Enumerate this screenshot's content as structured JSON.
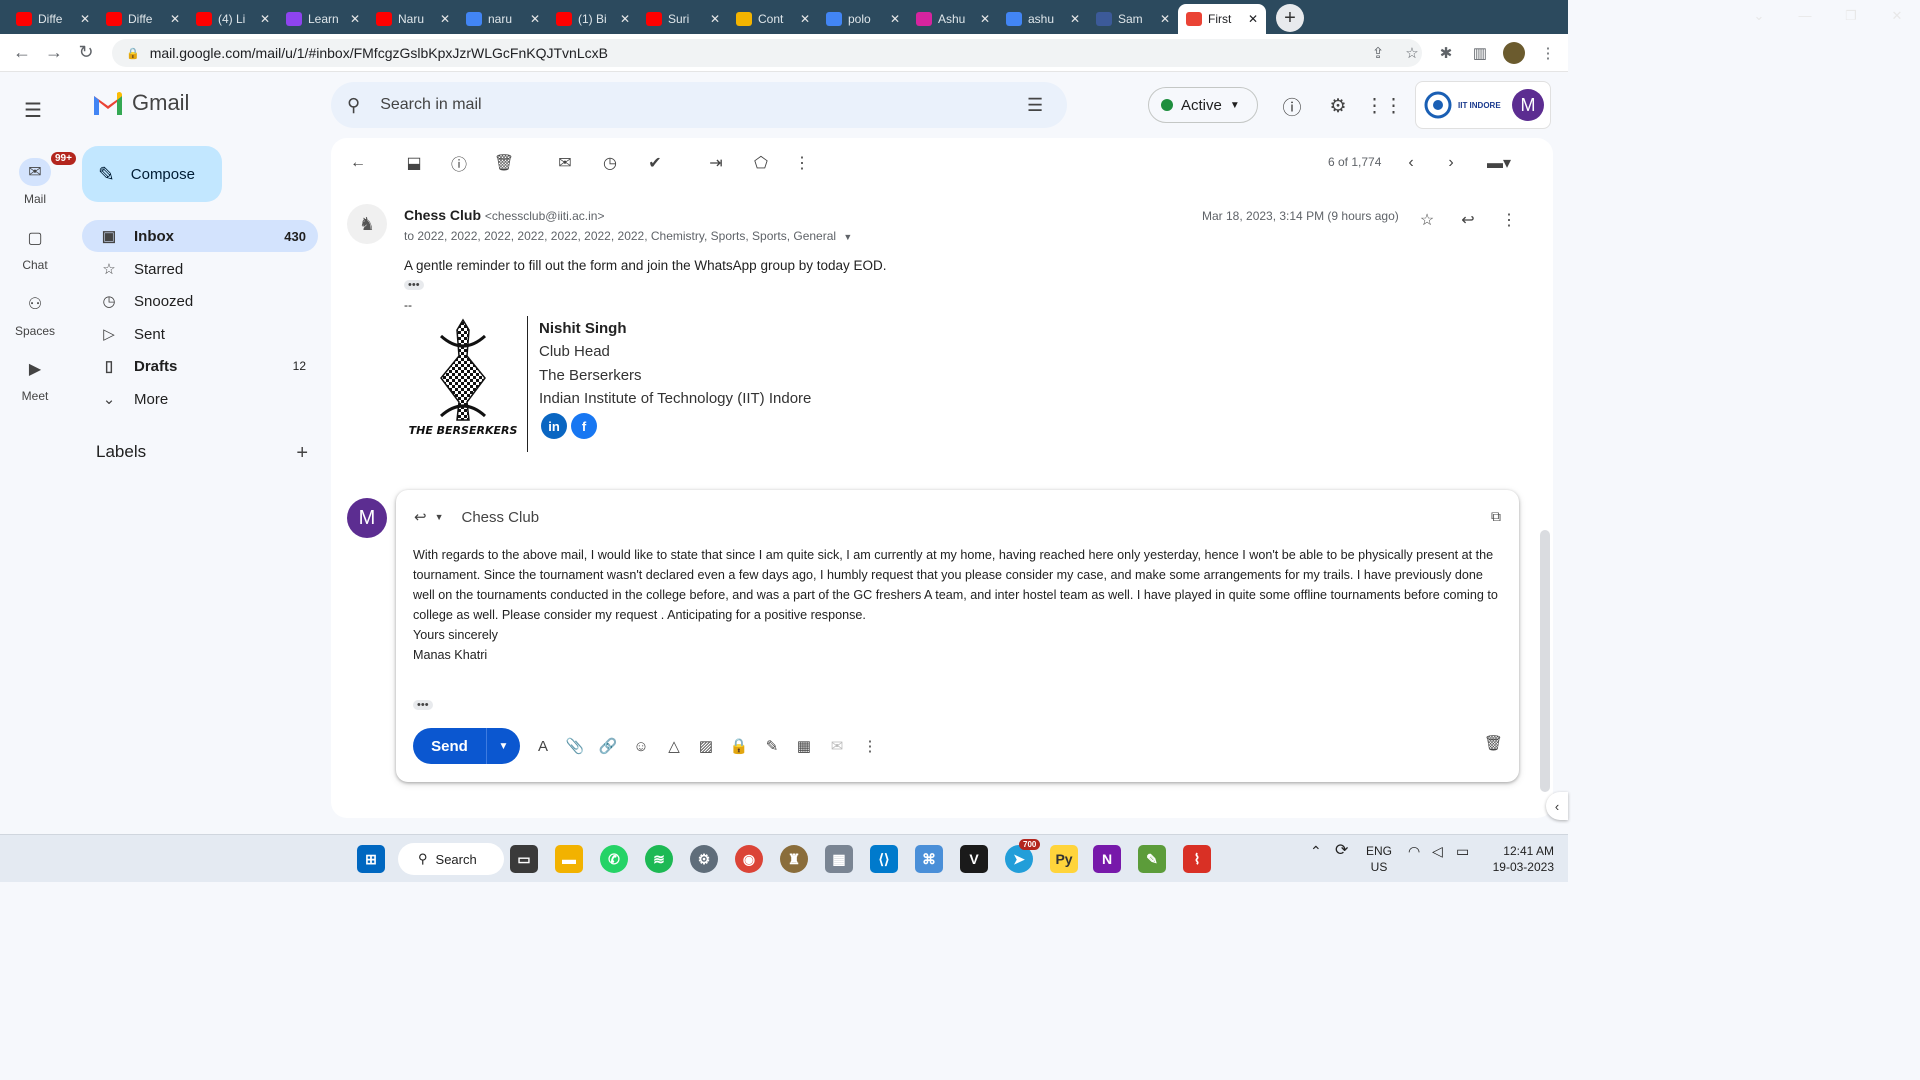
{
  "browser": {
    "tabs": [
      {
        "label": "Diffe",
        "color": "#ff0000"
      },
      {
        "label": "Diffe",
        "color": "#ff0000"
      },
      {
        "label": "(4) Li",
        "color": "#ff0000"
      },
      {
        "label": "Learn",
        "color": "#8e44ef"
      },
      {
        "label": "Naru",
        "color": "#ff0000"
      },
      {
        "label": "naru",
        "color": "#4285f4"
      },
      {
        "label": "(1) Bi",
        "color": "#ff0000"
      },
      {
        "label": "Suri",
        "color": "#ff0000"
      },
      {
        "label": "Cont",
        "color": "#f4b400"
      },
      {
        "label": "polo",
        "color": "#4285f4"
      },
      {
        "label": "Ashu",
        "color": "#d6249f"
      },
      {
        "label": "ashu",
        "color": "#4285f4"
      },
      {
        "label": "Sam",
        "color": "#3c5a99"
      },
      {
        "label": "First",
        "color": "#ea4335"
      }
    ],
    "url": "mail.google.com/mail/u/1/#inbox/FMfcgzGslbKpxJzrWLGcFnKQJTvnLcxB"
  },
  "rail": {
    "items": [
      {
        "label": "Mail",
        "badge": "99+"
      },
      {
        "label": "Chat"
      },
      {
        "label": "Spaces"
      },
      {
        "label": "Meet"
      }
    ]
  },
  "app": {
    "name": "Gmail"
  },
  "sidebar": {
    "compose": "Compose",
    "items": [
      {
        "label": "Inbox",
        "count": "430"
      },
      {
        "label": "Starred",
        "count": ""
      },
      {
        "label": "Snoozed",
        "count": ""
      },
      {
        "label": "Sent",
        "count": ""
      },
      {
        "label": "Drafts",
        "count": "12"
      },
      {
        "label": "More",
        "count": ""
      }
    ],
    "labels_title": "Labels"
  },
  "header": {
    "search_placeholder": "Search in mail",
    "status": "Active",
    "account_org": "IIT INDORE",
    "account_initial": "M"
  },
  "toolbar": {
    "pager": "6 of 1,774"
  },
  "email": {
    "sender_name": "Chess Club",
    "sender_email": "<chessclub@iiti.ac.in>",
    "to": "to 2022, 2022, 2022, 2022, 2022, 2022, 2022, Chemistry, Sports, Sports, General",
    "date": "Mar 18, 2023, 3:14 PM (9 hours ago)",
    "body": "A gentle reminder to fill out the form and join the WhatsApp group by today EOD.",
    "sig_dash": "--",
    "signature": {
      "logo_text": "THE BERSERKERS",
      "name": "Nishit Singh",
      "role": "Club Head",
      "club": "The Berserkers",
      "institute": "Indian Institute of Technology (IIT) Indore"
    }
  },
  "reply": {
    "avatar": "M",
    "to": "Chess Club",
    "body": "With regards to the above mail, I would like to state that since I am quite sick, I am currently at my home, having reached here only yesterday, hence I won't be able to be physically present at the tournament. Since the tournament wasn't declared even a few days ago, I humbly request that you please consider my case, and make some arrangements for my trails. I have previously done well on the tournaments conducted in the college before, and was a part of the GC freshers A team, and inter hostel team as well. I have played in quite some offline tournaments before coming to college as well. Please consider my request . Anticipating for a positive response.",
    "closing": "Yours sincerely",
    "signature": "Manas Khatri",
    "send_label": "Send"
  },
  "taskbar": {
    "search": "Search",
    "telegram_badge": "700",
    "lang": "ENG",
    "region": "US",
    "time": "12:41 AM",
    "date": "19-03-2023"
  }
}
